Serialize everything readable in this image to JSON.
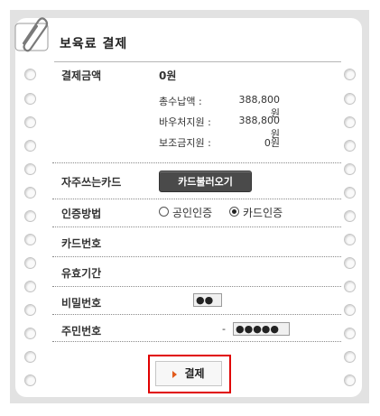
{
  "title": "보육료 결제",
  "payment": {
    "label": "결제금액",
    "amount": "0원",
    "breakdown": [
      {
        "label": "총수납액 :",
        "value": "388,800원"
      },
      {
        "label": "바우처지원 :",
        "value": "388,800원"
      },
      {
        "label": "보조금지원 :",
        "value": "0원"
      }
    ]
  },
  "favorite_card": {
    "label": "자주쓰는카드",
    "button": "카드불러오기"
  },
  "auth_method": {
    "label": "인증방법",
    "options": [
      {
        "label": "공인인증",
        "selected": false
      },
      {
        "label": "카드인증",
        "selected": true
      }
    ]
  },
  "card_number": {
    "label": "카드번호"
  },
  "expiry": {
    "label": "유효기간"
  },
  "password": {
    "label": "비밀번호",
    "value": "●●"
  },
  "resident_number": {
    "label": "주민번호",
    "separator": "-",
    "value": "●●●●●"
  },
  "pay_button": "결제",
  "colors": {
    "highlight": "#e00000",
    "arrow": "#e25a1c",
    "dark_button": "#4a4a4a"
  }
}
